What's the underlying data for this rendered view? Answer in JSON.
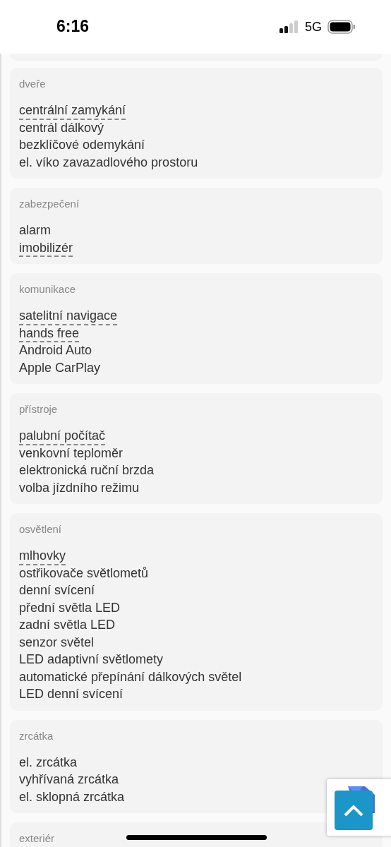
{
  "status_bar": {
    "time": "6:16",
    "network": "5G"
  },
  "sections": [
    {
      "title": "dveře",
      "items": [
        {
          "label": "centrální zamykání",
          "underlined": true
        },
        {
          "label": "centrál dálkový",
          "underlined": false
        },
        {
          "label": "bezklíčové odemykání",
          "underlined": false
        },
        {
          "label": "el. víko zavazadlového prostoru",
          "underlined": false
        }
      ]
    },
    {
      "title": "zabezpečení",
      "items": [
        {
          "label": "alarm",
          "underlined": false
        },
        {
          "label": "imobilizér",
          "underlined": true
        }
      ]
    },
    {
      "title": "komunikace",
      "items": [
        {
          "label": "satelitní navigace",
          "underlined": true
        },
        {
          "label": "hands free",
          "underlined": true
        },
        {
          "label": "Android Auto",
          "underlined": false
        },
        {
          "label": "Apple CarPlay",
          "underlined": false
        }
      ]
    },
    {
      "title": "přístroje",
      "items": [
        {
          "label": "palubní počítač",
          "underlined": true
        },
        {
          "label": "venkovní teploměr",
          "underlined": false
        },
        {
          "label": "elektronická ruční brzda",
          "underlined": false
        },
        {
          "label": "volba jízdního režimu",
          "underlined": false
        }
      ]
    },
    {
      "title": "osvětlení",
      "items": [
        {
          "label": "mlhovky",
          "underlined": true
        },
        {
          "label": "ostřikovače světlometů",
          "underlined": false
        },
        {
          "label": "denní svícení",
          "underlined": false
        },
        {
          "label": "přední světla LED",
          "underlined": false
        },
        {
          "label": "zadní světla LED",
          "underlined": false
        },
        {
          "label": "senzor světel",
          "underlined": false
        },
        {
          "label": "LED adaptivní světlomety",
          "underlined": false
        },
        {
          "label": "automatické přepínání dálkových světel",
          "underlined": false
        },
        {
          "label": "LED denní svícení",
          "underlined": false
        }
      ]
    },
    {
      "title": "zrcátka",
      "items": [
        {
          "label": "el. zrcátka",
          "underlined": false
        },
        {
          "label": "vyhřívaná zrcátka",
          "underlined": false
        },
        {
          "label": "el. sklopná zrcátka",
          "underlined": false
        }
      ]
    },
    {
      "title": "exteriér"
    }
  ]
}
